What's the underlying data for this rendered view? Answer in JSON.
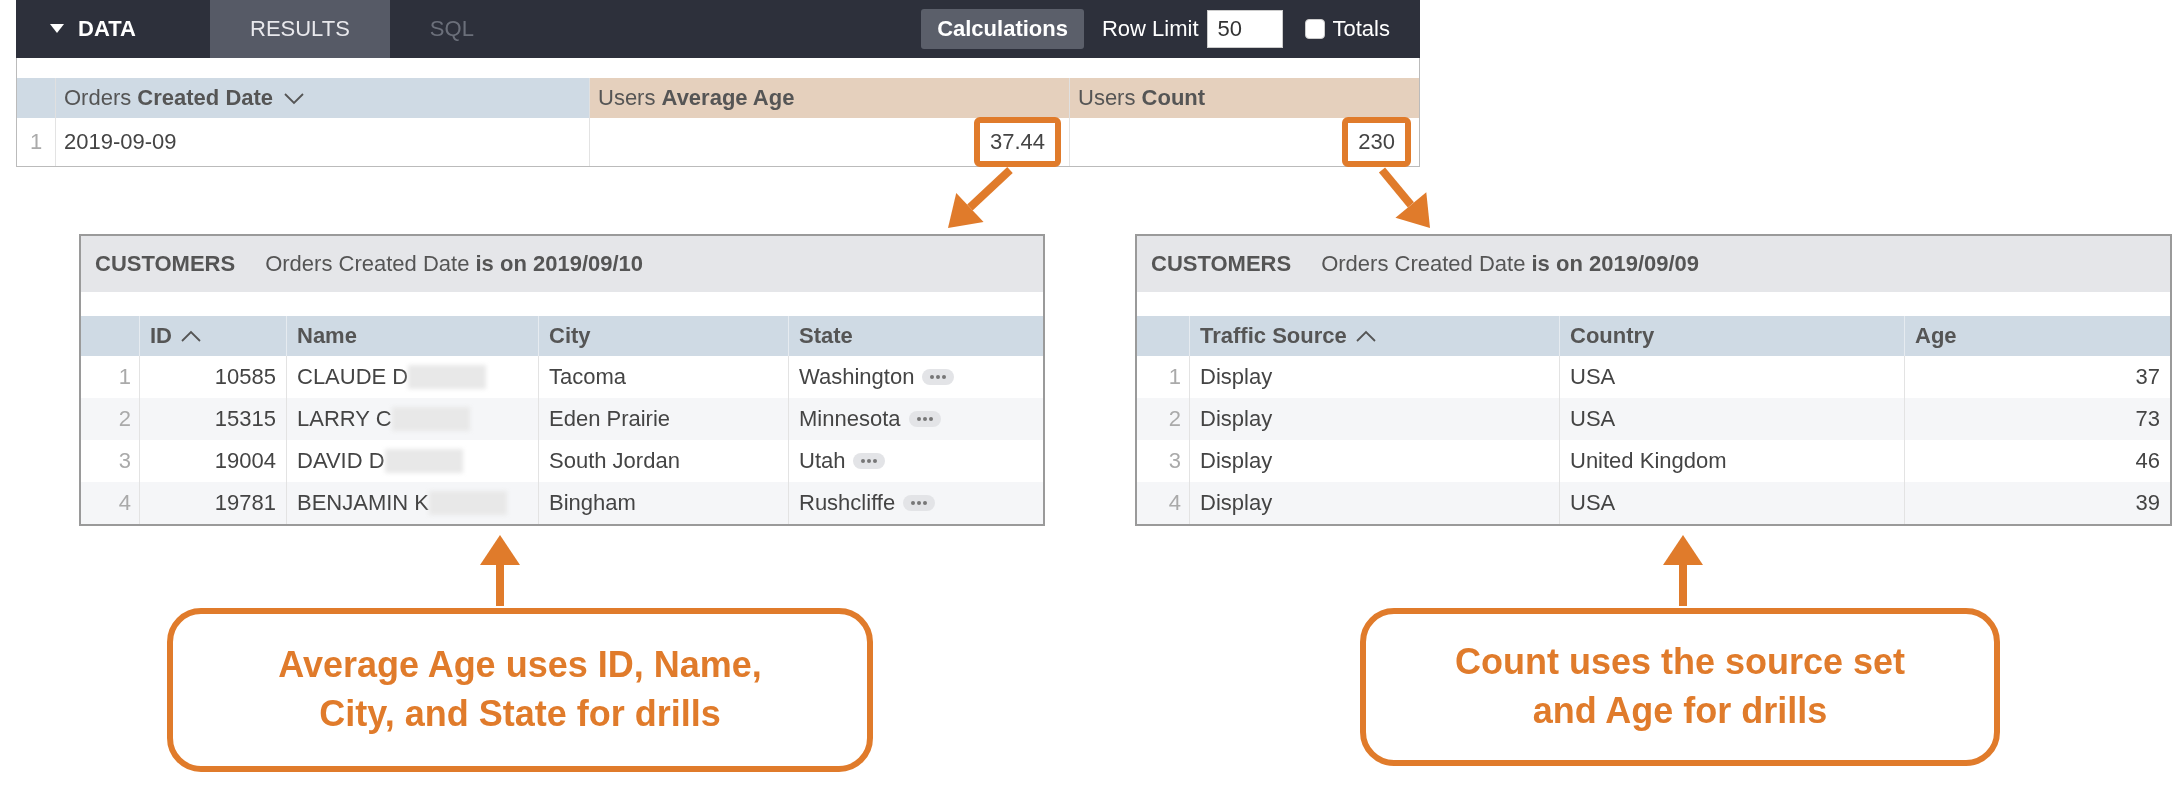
{
  "explore": {
    "section": "DATA",
    "tabs": [
      {
        "label": "RESULTS",
        "selected": true
      },
      {
        "label": "SQL",
        "selected": false
      }
    ],
    "calculations_button": "Calculations",
    "row_limit": {
      "label": "Row Limit",
      "value": "50"
    },
    "totals": {
      "label": "Totals",
      "checked": false
    },
    "columns": [
      {
        "label": "Orders **Created Date**",
        "kind": "dimension",
        "sorted": true,
        "descending": true
      },
      {
        "label": "Users **Average Age**",
        "kind": "measure",
        "sorted": false
      },
      {
        "label": "Users **Count**",
        "kind": "measure",
        "sorted": false
      }
    ],
    "rows": [
      {
        "number": "1",
        "cells": [
          {
            "value": "2019-09-09",
            "highlighted": false
          },
          {
            "value": "37.44",
            "highlighted": true
          },
          {
            "value": "230",
            "highlighted": true
          }
        ]
      }
    ]
  },
  "drills": [
    {
      "title": "CUSTOMERS",
      "filter": "Orders Created Date **is on 2019/09/10**",
      "columns": [
        {
          "label": "ID",
          "kind": "number",
          "sorted": true,
          "descending": false
        },
        {
          "label": "Name",
          "kind": "name",
          "sorted": false
        },
        {
          "label": "City",
          "kind": "text",
          "sorted": false
        },
        {
          "label": "State",
          "kind": "place",
          "sorted": false
        }
      ],
      "rows": [
        {
          "number": "1",
          "cells": [
            "10585",
            "CLAUDE D",
            "Tacoma",
            "Washington"
          ]
        },
        {
          "number": "2",
          "cells": [
            "15315",
            "LARRY C",
            "Eden Prairie",
            "Minnesota"
          ]
        },
        {
          "number": "3",
          "cells": [
            "19004",
            "DAVID D",
            "South Jordan",
            "Utah"
          ]
        },
        {
          "number": "4",
          "cells": [
            "19781",
            "BENJAMIN K",
            "Bingham",
            "Rushcliffe"
          ]
        }
      ]
    },
    {
      "title": "CUSTOMERS",
      "filter": "Orders Created Date **is on 2019/09/09**",
      "columns": [
        {
          "label": "Traffic Source",
          "kind": "text",
          "sorted": true,
          "descending": false
        },
        {
          "label": "Country",
          "kind": "text",
          "sorted": false
        },
        {
          "label": "Age",
          "kind": "number",
          "sorted": false
        }
      ],
      "rows": [
        {
          "number": "1",
          "cells": [
            "Display",
            "USA",
            "37"
          ]
        },
        {
          "number": "2",
          "cells": [
            "Display",
            "USA",
            "73"
          ]
        },
        {
          "number": "3",
          "cells": [
            "Display",
            "United Kingdom",
            "46"
          ]
        },
        {
          "number": "4",
          "cells": [
            "Display",
            "USA",
            "39"
          ]
        }
      ]
    }
  ],
  "callouts": [
    {
      "text": "Average Age uses ID, Name, City, and State for drills"
    },
    {
      "text": "Count uses the source set and Age for drills"
    }
  ]
}
